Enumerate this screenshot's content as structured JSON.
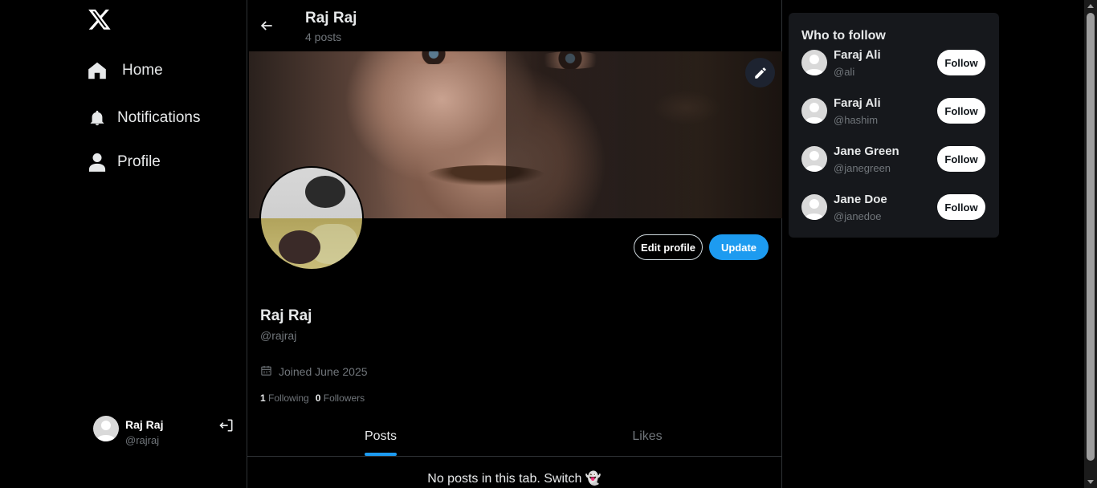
{
  "icons": {
    "logo": "x-logo-icon",
    "home": "home-icon",
    "notifications": "bell-icon",
    "profile": "person-icon",
    "logout": "logout-icon",
    "back": "arrow-left-icon",
    "edit_banner": "pencil-icon",
    "calendar": "calendar-icon"
  },
  "sidebar": {
    "items": [
      {
        "label": "Home"
      },
      {
        "label": "Notifications"
      },
      {
        "label": "Profile"
      }
    ],
    "account": {
      "name": "Raj Raj",
      "handle": "@rajraj"
    }
  },
  "header": {
    "name": "Raj Raj",
    "posts": "4 posts"
  },
  "profile": {
    "name": "Raj Raj",
    "handle": "@rajraj",
    "joined": "Joined June 2025",
    "following_count": "1",
    "following_label": "Following",
    "followers_count": "0",
    "followers_label": "Followers",
    "edit_label": "Edit profile",
    "update_label": "Update"
  },
  "tabs": [
    {
      "label": "Posts",
      "active": true
    },
    {
      "label": "Likes",
      "active": false
    }
  ],
  "empty_message": "No posts in this tab. Switch 👻",
  "who_to_follow": {
    "title": "Who to follow",
    "follow_label": "Follow",
    "users": [
      {
        "name": "Faraj Ali",
        "handle": "@ali"
      },
      {
        "name": "Faraj Ali",
        "handle": "@hashim"
      },
      {
        "name": "Jane Green",
        "handle": "@janegreen"
      },
      {
        "name": "Jane Doe",
        "handle": "@janedoe"
      }
    ]
  },
  "colors": {
    "accent": "#1d9bf0",
    "background": "#000000",
    "muted": "#71767b"
  }
}
